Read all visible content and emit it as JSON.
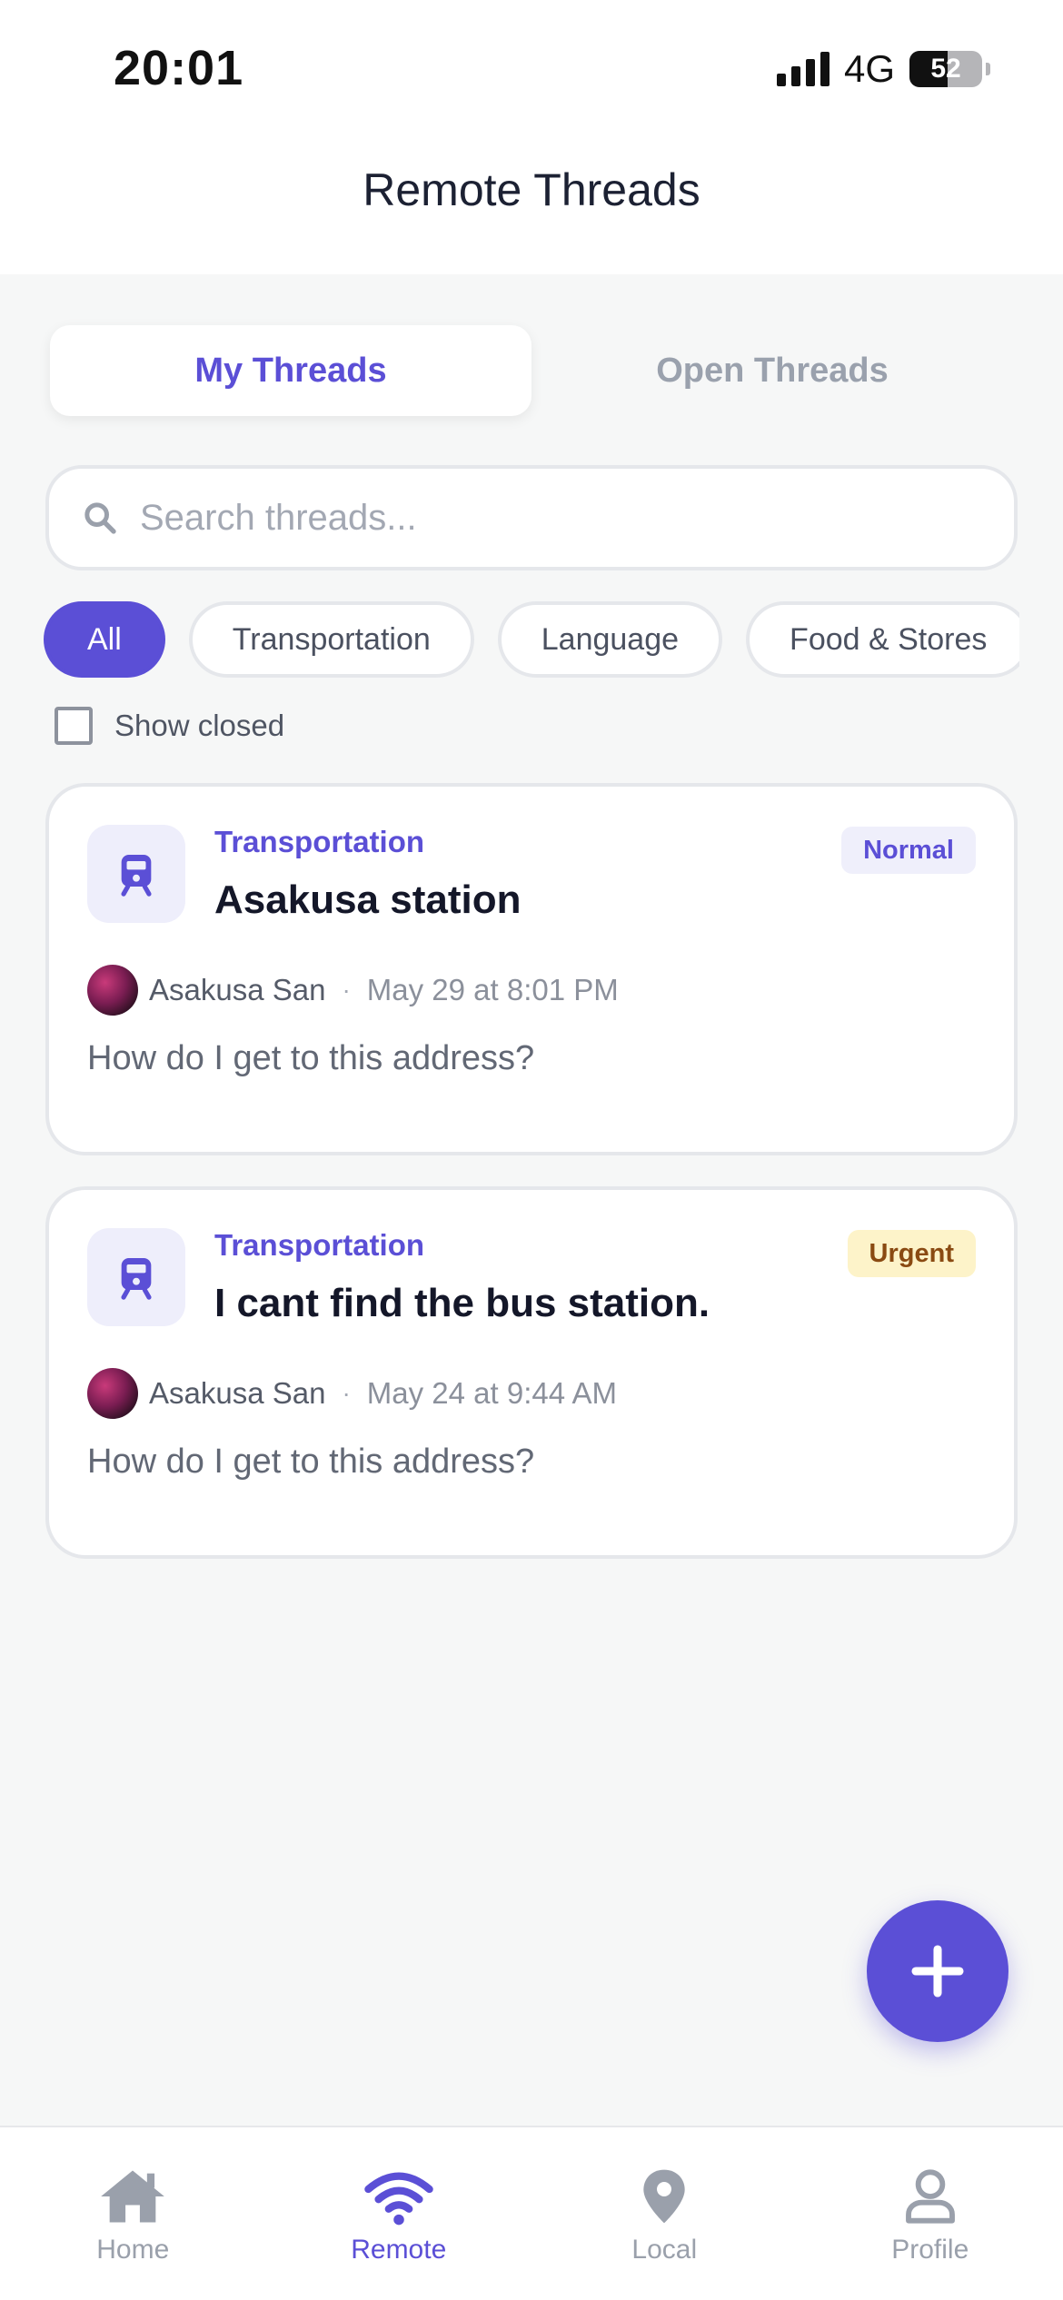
{
  "status_bar": {
    "time": "20:01",
    "network": "4G",
    "battery": "52",
    "battery_level": 0.52
  },
  "header": {
    "title": "Remote Threads"
  },
  "tabs": [
    {
      "label": "My Threads",
      "active": true
    },
    {
      "label": "Open Threads",
      "active": false
    }
  ],
  "search": {
    "placeholder": "Search threads...",
    "value": ""
  },
  "filters": [
    {
      "label": "All",
      "active": true
    },
    {
      "label": "Transportation",
      "active": false
    },
    {
      "label": "Language",
      "active": false
    },
    {
      "label": "Food & Stores",
      "active": false
    }
  ],
  "show_closed": {
    "label": "Show closed",
    "checked": false
  },
  "threads": [
    {
      "category": "Transportation",
      "title": "Asakusa station",
      "priority": "Normal",
      "author": "Asakusa San",
      "separator": "·",
      "date": "May 29 at 8:01 PM",
      "body": "How do I get to this address?",
      "icon": "train-icon"
    },
    {
      "category": "Transportation",
      "title": "I cant find the bus station.",
      "priority": "Urgent",
      "author": "Asakusa San",
      "separator": "·",
      "date": "May 24 at 9:44 AM",
      "body": "How do I get to this address?",
      "icon": "train-icon"
    }
  ],
  "fab": {
    "icon": "plus-icon"
  },
  "bottom_nav": [
    {
      "label": "Home",
      "icon": "home-icon",
      "active": false
    },
    {
      "label": "Remote",
      "icon": "wifi-icon",
      "active": true
    },
    {
      "label": "Local",
      "icon": "map-pin-icon",
      "active": false
    },
    {
      "label": "Profile",
      "icon": "user-icon",
      "active": false
    }
  ],
  "colors": {
    "accent": "#5b4fd6",
    "urgent_bg": "#fdf3c9",
    "urgent_text": "#8a4a12",
    "normal_bg": "#efeffb"
  }
}
